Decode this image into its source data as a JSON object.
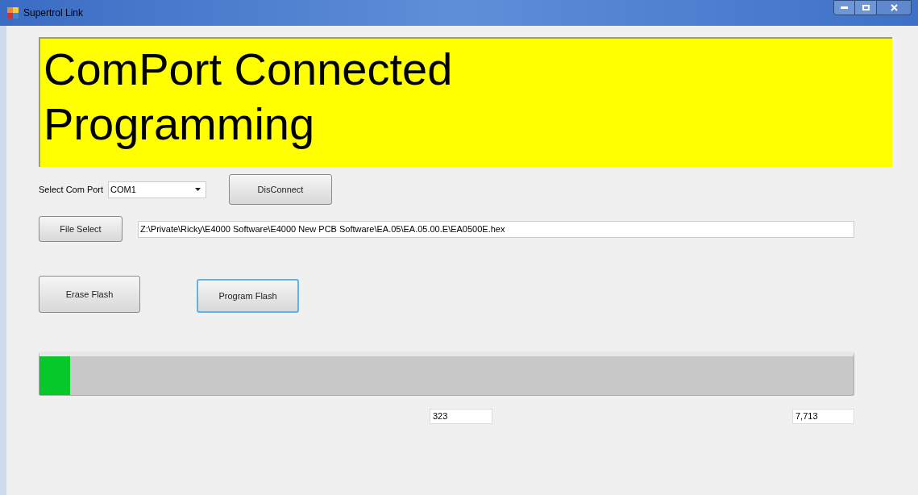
{
  "window": {
    "title": "Supertrol Link"
  },
  "status_banner": {
    "lines": [
      "ComPort Connected",
      "Programming"
    ]
  },
  "com_port": {
    "label": "Select Com Port",
    "value": "COM1"
  },
  "buttons": [
    {
      "label": "DisConnect",
      "focused": false
    },
    {
      "label": "File Select",
      "focused": false
    },
    {
      "label": "Erase Flash",
      "focused": false
    },
    {
      "label": "Program Flash",
      "focused": true
    }
  ],
  "file_path": {
    "value": "Z:\\Private\\Ricky\\E4000 Software\\E4000 New PCB Software\\EA.05\\EA.05.00.E\\EA0500E.hex"
  },
  "progress": {
    "level": 0.038
  },
  "current_count": {
    "value": "323"
  },
  "total_count": {
    "value": "7,713"
  }
}
